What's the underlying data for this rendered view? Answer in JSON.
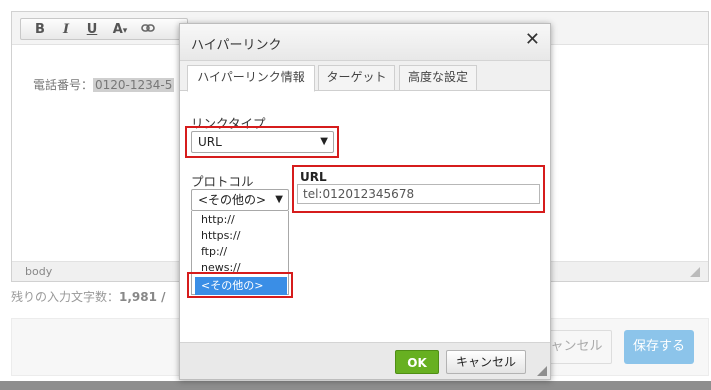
{
  "editor": {
    "toolbar": {
      "bold": "B",
      "italic": "I",
      "underline": "U",
      "font_color": "A",
      "font_color_caret": "▾",
      "link_icon": "link-icon"
    },
    "content": {
      "label": "電話番号：",
      "phone": "0120-1234-5"
    },
    "footer_tag": "body"
  },
  "char_count": {
    "label": "残りの入力文字数：",
    "value": "1,981 /"
  },
  "bg_buttons": {
    "cancel": "キャンセル",
    "save": "保存する"
  },
  "dialog": {
    "title": "ハイパーリンク",
    "close": "✕",
    "tabs": [
      {
        "label": "ハイパーリンク情報",
        "active": true
      },
      {
        "label": "ターゲット",
        "active": false
      },
      {
        "label": "高度な設定",
        "active": false
      }
    ],
    "link_type": {
      "label": "リンクタイプ",
      "value": "URL"
    },
    "protocol": {
      "label": "プロトコル",
      "value": "<その他の>",
      "options": [
        "http://",
        "https://",
        "ftp://",
        "news://",
        "<その他の>"
      ],
      "selected_index": 4
    },
    "url": {
      "label": "URL",
      "value": "tel:012012345678"
    },
    "buttons": {
      "ok": "OK",
      "cancel": "キャンセル"
    }
  },
  "colors": {
    "highlight": "#d61c1c",
    "ok_green": "#67b021",
    "selected_blue": "#3a8ee6",
    "save_blue": "#8cc4ea"
  }
}
